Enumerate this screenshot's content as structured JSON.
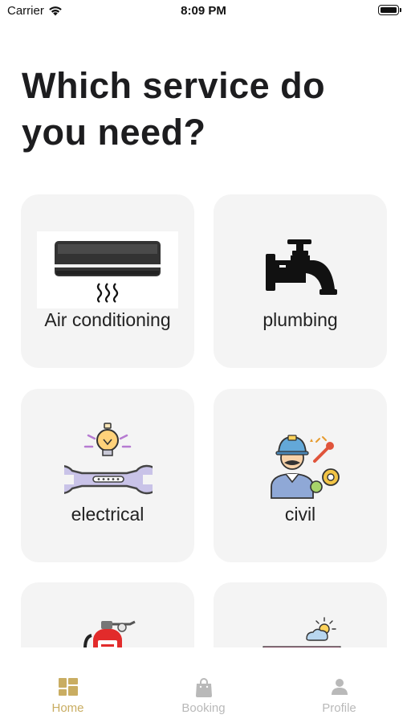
{
  "status_bar": {
    "carrier": "Carrier",
    "time": "8:09 PM"
  },
  "header": {
    "title": "Which service do you need?"
  },
  "services": [
    {
      "label": "Air conditioning",
      "icon": "air-conditioner-icon"
    },
    {
      "label": "plumbing",
      "icon": "faucet-icon"
    },
    {
      "label": "electrical",
      "icon": "bulb-wrench-icon"
    },
    {
      "label": "civil",
      "icon": "worker-icon"
    },
    {
      "label": "",
      "icon": "fire-extinguisher-icon"
    },
    {
      "label": "",
      "icon": "table-sun-icon"
    }
  ],
  "tab_bar": {
    "active_color": "#c9ad62",
    "inactive_color": "#b9b9b9",
    "tabs": [
      {
        "label": "Home",
        "icon": "home-grid-icon",
        "active": true
      },
      {
        "label": "Booking",
        "icon": "shopping-bag-icon",
        "active": false
      },
      {
        "label": "Profile",
        "icon": "person-icon",
        "active": false
      }
    ]
  }
}
